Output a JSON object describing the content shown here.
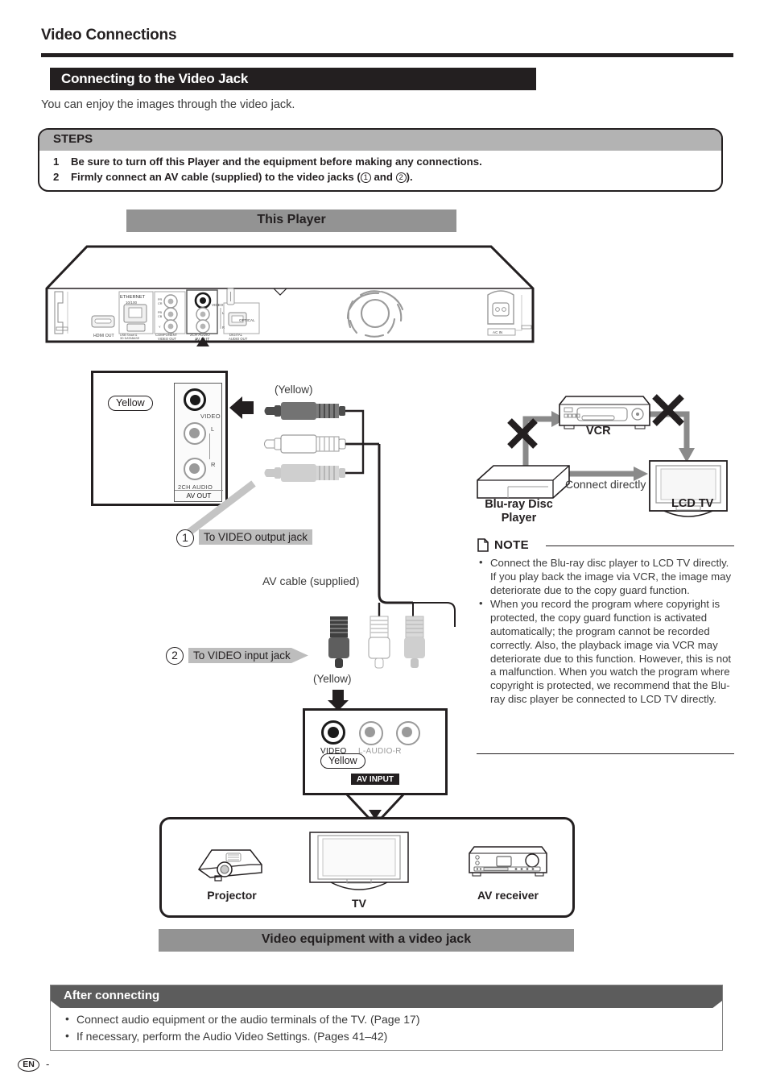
{
  "header": {
    "page_title": "Video Connections",
    "section_title": "Connecting to the Video Jack",
    "intro": "You can enjoy the images through the video jack."
  },
  "steps": {
    "heading": "STEPS",
    "items": [
      {
        "num": "1",
        "text": "Be sure to turn off this Player and the equipment before making any connections."
      },
      {
        "num": "2",
        "text_before": "Firmly connect an AV cable (supplied) to the video jacks (",
        "circled_1": "1",
        "text_mid": " and ",
        "circled_2": "2",
        "text_after": ")."
      }
    ]
  },
  "player": {
    "banner": "This Player",
    "rear_labels": {
      "hdmi": "HDMI OUT",
      "ethernet": "ETHERNET",
      "ethernet_sub": "10/100",
      "usb": "USB Smart & 3D DATABASE",
      "component": "COMPONENT VIDEO OUT",
      "av_out": "2CH AUDIO AV OUT",
      "digital": "DIGITAL AUDIO OUT",
      "optical": "OPTICAL",
      "ac_in": "AC IN",
      "video": "VIDEO",
      "pr": "PR",
      "cr": "CR",
      "pb": "PB",
      "cb": "CB",
      "y": "Y",
      "l": "L",
      "r": "R"
    }
  },
  "avout_detail": {
    "yellow_pill": "Yellow",
    "video_label": "VIDEO",
    "l_label": "L",
    "r_label": "R",
    "audio_label": "2CH AUDIO",
    "badge": "AV OUT"
  },
  "avin_detail": {
    "video_label": "VIDEO",
    "audio_label": "L-AUDIO-R",
    "yellow_pill": "Yellow",
    "badge": "AV INPUT"
  },
  "callouts": {
    "one_num": "1",
    "one_label": "To VIDEO output jack",
    "two_num": "2",
    "two_label": "To VIDEO input jack",
    "av_cable": "AV cable (supplied)",
    "yellow_top": "(Yellow)",
    "yellow_bottom": "(Yellow)"
  },
  "vcr_diagram": {
    "vcr_label": "VCR",
    "player_label": "Blu-ray Disc Player",
    "tv_label": "LCD TV",
    "connect_directly": "Connect directly"
  },
  "note": {
    "heading": "NOTE",
    "items": [
      "Connect the Blu-ray disc player to LCD TV directly. If you play back the image via VCR, the image may deteriorate due to the copy guard function.",
      "When you record the program where copyright is protected, the copy guard function is activated automatically; the program cannot be recorded correctly. Also, the playback image via VCR may deteriorate due to this function. However, this is not a malfunction. When you watch the program where copyright is protected, we recommend that the Blu-ray disc player be connected to LCD TV directly."
    ]
  },
  "equipment": {
    "banner": "Video equipment with a video jack",
    "items": [
      {
        "label": "Projector"
      },
      {
        "label": "TV"
      },
      {
        "label": "AV receiver"
      }
    ]
  },
  "after_connecting": {
    "heading": "After connecting",
    "items": [
      "Connect audio equipment or the audio terminals of the TV. (Page 17)",
      "If necessary, perform the Audio Video Settings. (Pages 41–42)"
    ]
  },
  "footer": {
    "lang": "EN",
    "dash": "-"
  },
  "colors": {
    "ink": "#231f20",
    "banner_gray": "#939393",
    "steps_gray": "#b3b3b3",
    "label_gray": "#bdbdbd",
    "after_gray": "#5c5c5c",
    "yellow_plug": "#4d4d4d",
    "gray_plug": "#c9c9c9"
  }
}
